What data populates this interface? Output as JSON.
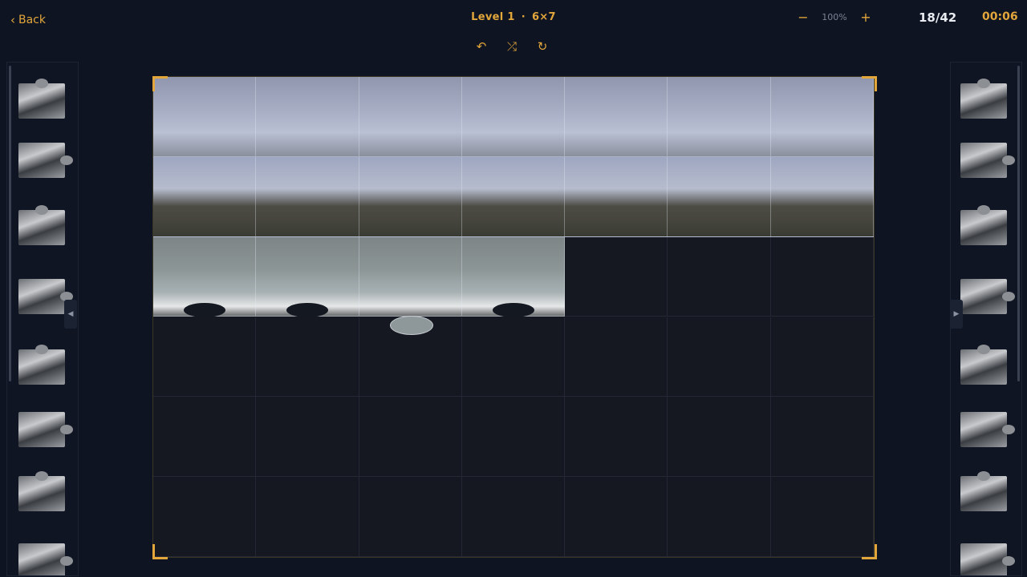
{
  "header": {
    "back_label": "Back",
    "level_label": "Level 1",
    "separator": "·",
    "grid_label": "6×7",
    "zoom_out": "−",
    "zoom_value": "100%",
    "zoom_in": "+",
    "progress": "18/42",
    "timer": "00:06"
  },
  "toolbar": {
    "undo_icon": "↶",
    "shuffle_icon": "⤮",
    "redo_icon": "↻"
  },
  "trays": {
    "left_collapse": "◀",
    "right_collapse": "▶",
    "left_piece_count": 8,
    "right_piece_count": 8
  },
  "board": {
    "rows": 6,
    "cols": 7,
    "placed_pieces": 18,
    "accent_color": "#e2a63b"
  }
}
